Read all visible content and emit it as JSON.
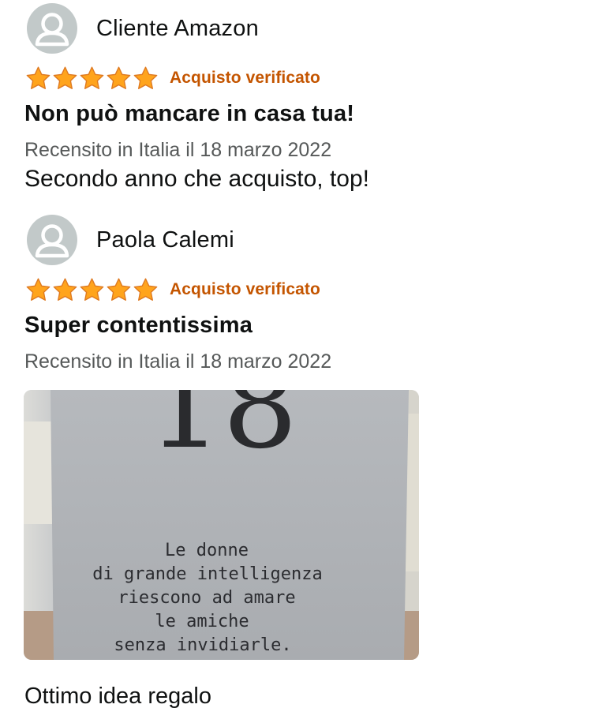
{
  "reviews": [
    {
      "author": "Cliente Amazon",
      "rating": 5,
      "rating_max": 5,
      "verified_label": "Acquisto verificato",
      "title": "Non può mancare in casa tua!",
      "date_line": "Recensito in Italia il 18 marzo 2022",
      "body": "Secondo anno che acquisto, top!"
    },
    {
      "author": "Paola Calemi",
      "rating": 5,
      "rating_max": 5,
      "verified_label": "Acquisto verificato",
      "title": "Super contentissima",
      "date_line": "Recensito in Italia il 18 marzo 2022",
      "photo": {
        "big_number": "18",
        "quote_lines": [
          "Le donne",
          "di grande intelligenza",
          "riescono ad amare",
          "le amiche",
          "senza invidiarle."
        ]
      },
      "body": "Ottimo idea regalo"
    }
  ],
  "colors": {
    "star": "#ffa41c",
    "verified": "#c45500",
    "avatar_bg": "#c2c9c9",
    "secondary_text": "#565959"
  },
  "icons": {
    "avatar": "user-avatar-icon",
    "star": "star-icon"
  }
}
